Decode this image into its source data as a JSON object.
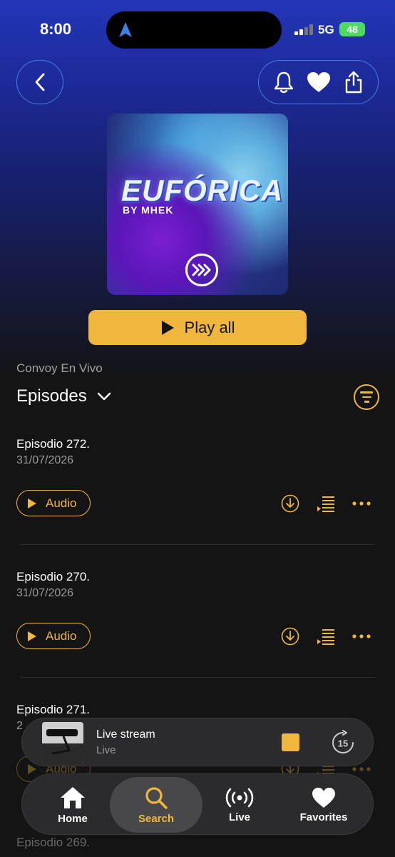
{
  "status": {
    "time": "8:00",
    "network": "5G",
    "battery": "48"
  },
  "cover": {
    "title": "EUFÓRICA",
    "subtitle": "BY MHEK"
  },
  "play_all_label": "Play all",
  "show_name": "Convoy En Vivo",
  "section_title": "Episodes",
  "episodes": [
    {
      "title": "Episodio 272.",
      "date": "31/07/2026",
      "audio_label": "Audio"
    },
    {
      "title": "Episodio 270.",
      "date": "31/07/2026",
      "audio_label": "Audio"
    },
    {
      "title": "Episodio 271.",
      "date": "2",
      "audio_label": "Audio"
    },
    {
      "title": "Episodio 269.",
      "date": ""
    }
  ],
  "mini_player": {
    "title": "Live stream",
    "subtitle": "Live",
    "skip_seconds": "15"
  },
  "tabs": [
    {
      "label": "Home",
      "icon": "home-icon"
    },
    {
      "label": "Search",
      "icon": "search-icon",
      "active": true
    },
    {
      "label": "Live",
      "icon": "broadcast-icon"
    },
    {
      "label": "Favorites",
      "icon": "heart-icon"
    }
  ],
  "colors": {
    "accent": "#f0b73f",
    "header_blue": "#2336b8",
    "background": "#141414",
    "pill_border": "#4a79e6"
  }
}
